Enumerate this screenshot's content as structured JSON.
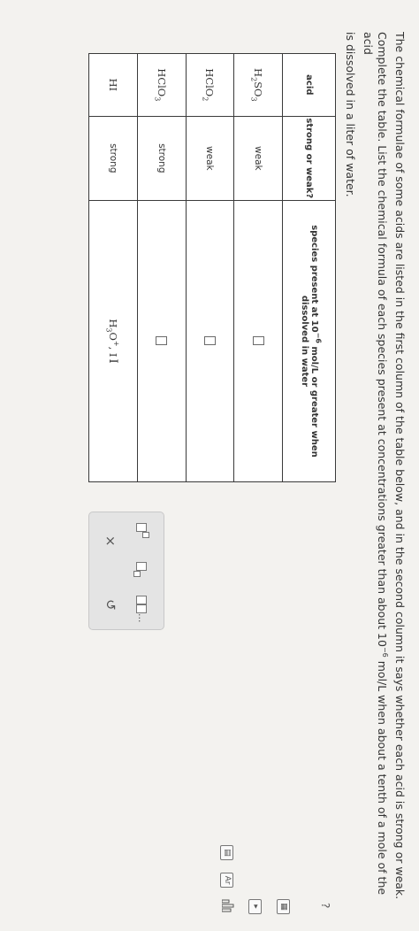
{
  "prompt": {
    "line1": "The chemical formulae of some acids are listed in the first column of the table below, and in the second column it says whether each acid is strong or weak.",
    "line2_a": "Complete the table. List the chemical formula of each species present at concentrations greater than about 10",
    "line2_exp": "−6",
    "line2_b": " mol/L when about a tenth of a mole of the acid",
    "line3": "is dissolved in a liter of water."
  },
  "table": {
    "headers": {
      "acid": "acid",
      "strength": "strong or weak?",
      "species_a": "species present at 10",
      "species_exp": "−6",
      "species_b": " mol/L or greater when dissolved in water"
    },
    "rows": [
      {
        "acid_main": "H",
        "acid_sub1": "2",
        "acid_mid": "SO",
        "acid_sub2": "3",
        "strength": "weak",
        "answer": ""
      },
      {
        "acid_main": "HClO",
        "acid_sub1": "",
        "acid_mid": "",
        "acid_sub2": "2",
        "strength": "weak",
        "answer": ""
      },
      {
        "acid_main": "HClO",
        "acid_sub1": "",
        "acid_mid": "",
        "acid_sub2": "3",
        "strength": "strong",
        "answer": ""
      },
      {
        "acid_main": "HI",
        "acid_sub1": "",
        "acid_mid": "",
        "acid_sub2": "",
        "strength": "strong",
        "answer_h": "H",
        "answer_sub": "3",
        "answer_o": "O",
        "answer_sup": "+",
        "answer_rest": ", I"
      }
    ]
  },
  "palette": {
    "clear_symbol": "×",
    "undo_symbol": "↺",
    "ellipsis": "..."
  },
  "tools": {
    "help": "?",
    "bar_chart": "bar-chart-icon",
    "periodic_table": "Ar"
  }
}
